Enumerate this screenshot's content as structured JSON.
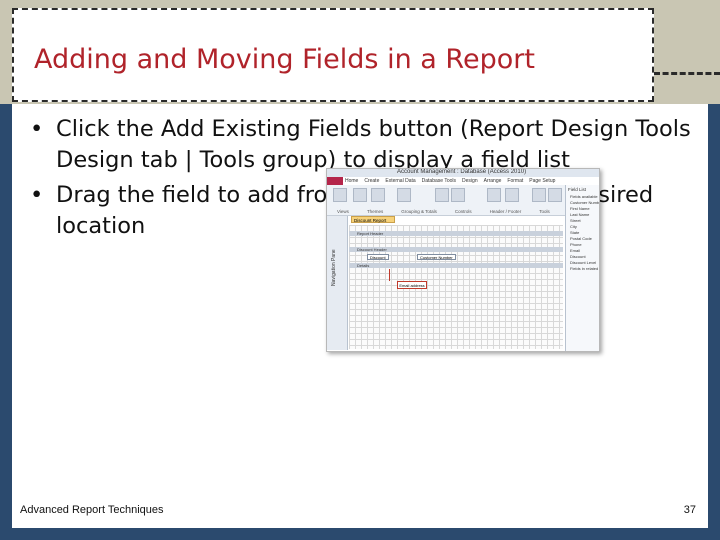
{
  "slide": {
    "title": "Adding and Moving Fields in a Report",
    "bullets": [
      "Click the Add Existing Fields button (Report Design Tools Design tab | Tools group) to display a field list",
      "Drag the field to add from the field list to the desired location"
    ],
    "bullet_symbol": "•",
    "footer_left": "Advanced Report Techniques",
    "page_number": "37"
  },
  "colors": {
    "title": "#b0232a",
    "background": "#2b4a6e",
    "band": "#c9c6b3"
  },
  "screenshot": {
    "window_title": "Account Management : Database (Access 2010)",
    "file_tab": "File",
    "tabs": [
      "Home",
      "Create",
      "External Data",
      "Database Tools",
      "Design",
      "Arrange",
      "Format",
      "Page Setup"
    ],
    "group_labels": [
      "Views",
      "Themes",
      "Grouping & Totals",
      "Controls",
      "Header / Footer",
      "Tools"
    ],
    "nav_pane_label": "Navigation Pane",
    "document_tab": "Discount Report",
    "sections": [
      "Report Header",
      "Discount Header",
      "Details"
    ],
    "controls": [
      "Discount",
      "Customer Number"
    ],
    "callout": "Email address",
    "field_list_title": "Field List",
    "field_list_items": [
      "Fields available",
      "Customer Number",
      "First Name",
      "Last Name",
      "Street",
      "City",
      "State",
      "Postal Code",
      "Phone",
      "Email",
      "Discount",
      "Discount Level",
      "Fields in related"
    ]
  }
}
